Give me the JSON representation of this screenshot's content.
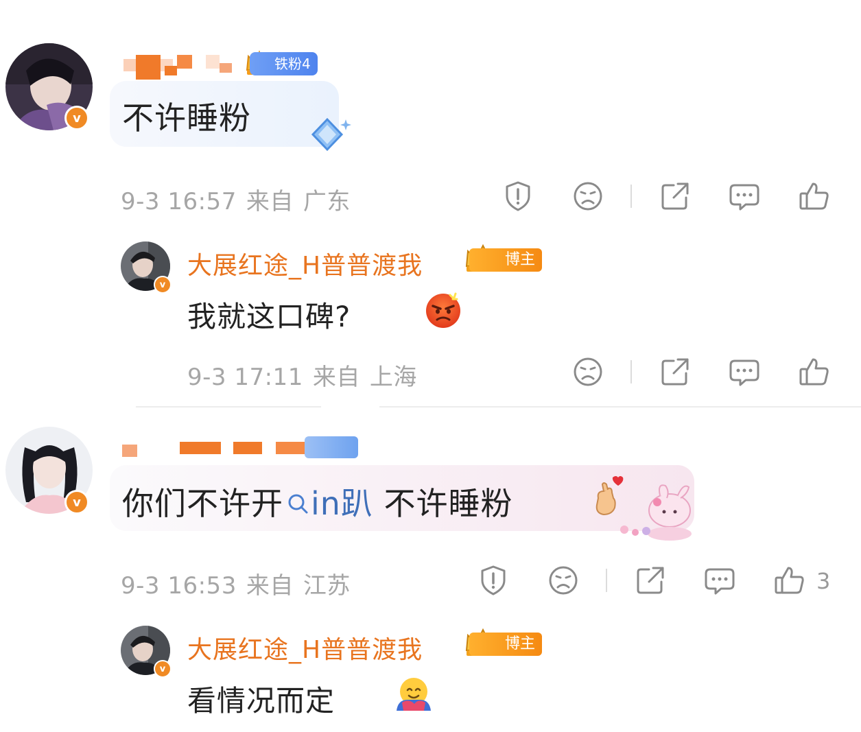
{
  "comments": [
    {
      "badge": "铁粉4",
      "text": "不许睡粉",
      "time": "9-3 16:57",
      "from_label": "来自",
      "location": "广东",
      "reply": {
        "username": "大展红途_H普普渡我",
        "badge": "博主",
        "text": "我就这口碑?",
        "emoji": "angry-face",
        "time": "9-3 17:11",
        "from_label": "来自",
        "location": "上海"
      }
    },
    {
      "text_before": "你们不许开",
      "link_text": "in趴",
      "text_after": " 不许睡粉",
      "emoji": "finger-heart",
      "time": "9-3 16:53",
      "from_label": "来自",
      "location": "江苏",
      "like_count": "3",
      "reply": {
        "username": "大展红途_H普普渡我",
        "badge": "博主",
        "text": "看情况而定",
        "emoji": "hugging-face"
      }
    }
  ],
  "colors": {
    "username": "#e8741f",
    "meta_text": "#a6a6a6",
    "fan_badge": "#5b8ef0",
    "owner_badge": "#f5941a",
    "verified_badge": "#f08a24"
  },
  "icons": [
    "report-icon",
    "dislike-icon",
    "share-icon",
    "comment-icon",
    "like-icon"
  ]
}
